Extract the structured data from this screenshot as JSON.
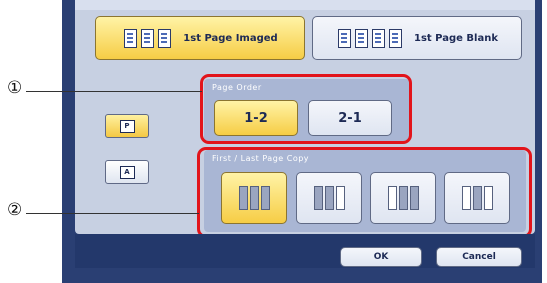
{
  "top_buttons": {
    "first_imaged": "1st Page Imaged",
    "first_blank": "1st Page Blank"
  },
  "page_order": {
    "title": "Page Order",
    "options": [
      "1-2",
      "2-1"
    ]
  },
  "first_last_copy": {
    "title": "First / Last Page Copy"
  },
  "side_buttons": [
    "P",
    "A"
  ],
  "bottom": {
    "ok_label": "OK",
    "cancel_label": "Cancel"
  },
  "callouts": [
    "①",
    "②"
  ]
}
